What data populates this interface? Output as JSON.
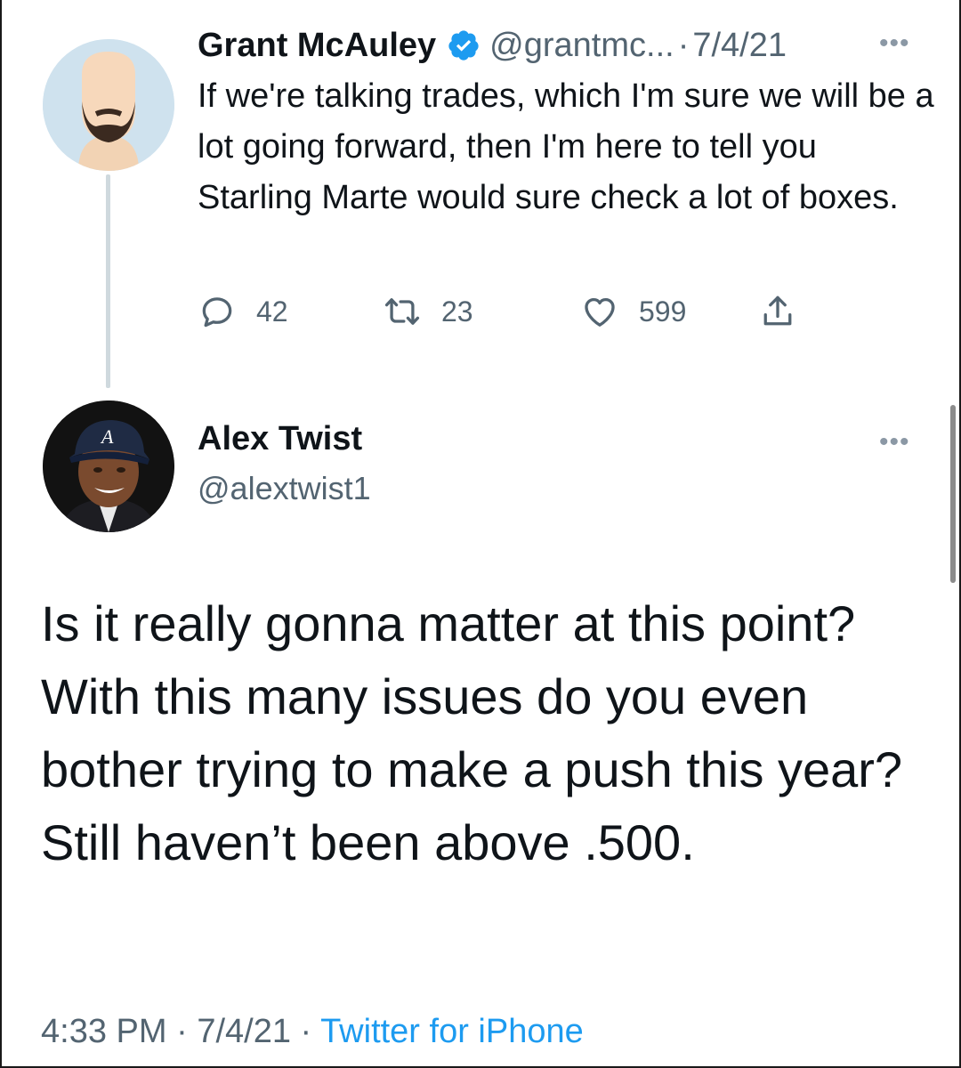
{
  "parent_tweet": {
    "author_name": "Grant McAuley",
    "verified": true,
    "handle": "@grantmc...",
    "separator": "·",
    "date": "7/4/21",
    "more_icon": "more-horizontal-icon",
    "text": "If we're talking trades, which I'm sure we will be a lot going forward, then I'm here to tell you Starling Marte would sure check a lot of boxes.",
    "actions": {
      "reply": {
        "icon": "reply-bubble-icon",
        "count": "42"
      },
      "retweet": {
        "icon": "retweet-icon",
        "count": "23"
      },
      "like": {
        "icon": "heart-icon",
        "count": "599"
      },
      "share": {
        "icon": "share-upload-icon"
      }
    }
  },
  "reply_tweet": {
    "author_name": "Alex Twist",
    "handle": "@alextwist1",
    "more_icon": "more-horizontal-icon",
    "text": "Is it really gonna matter at this point? With this many issues do you even bother trying to make a push this year? Still haven’t been above .500.",
    "time": "4:33 PM",
    "separator": "·",
    "date": "7/4/21",
    "source": "Twitter for iPhone"
  },
  "colors": {
    "text_primary": "#0f1419",
    "text_secondary": "#536471",
    "verified_blue": "#1d9bf0",
    "link_blue": "#1d9bf0",
    "thread_line": "#cfd9de"
  }
}
